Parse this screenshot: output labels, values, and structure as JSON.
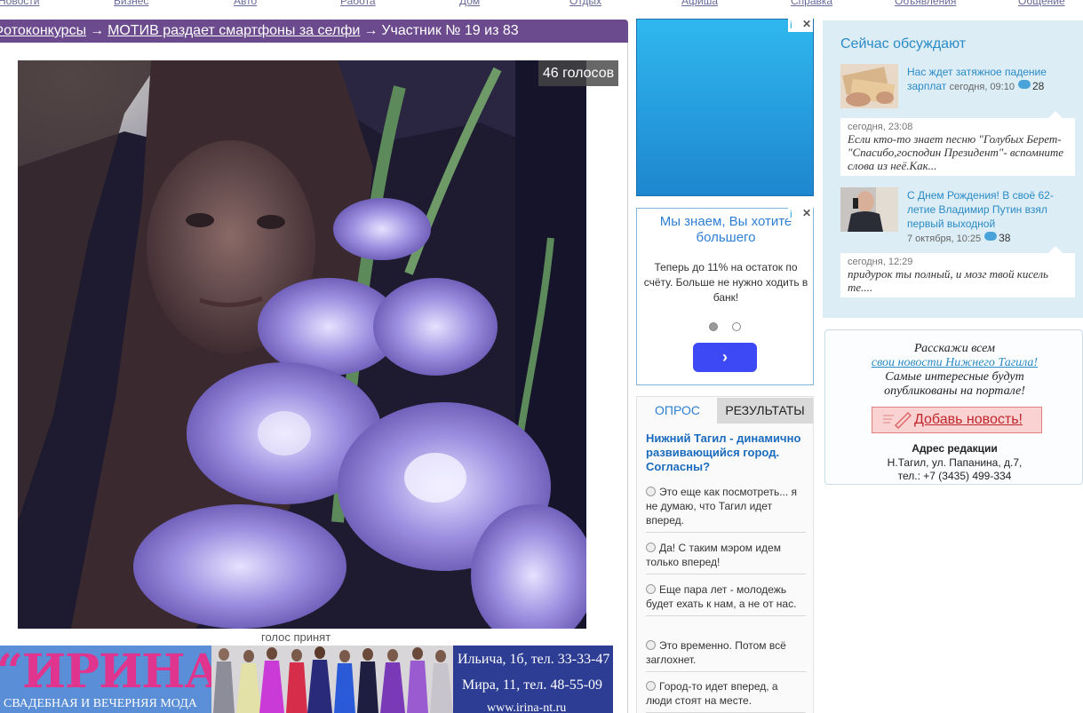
{
  "topnav": [
    {
      "label": "Новости"
    },
    {
      "label": "Бизнес"
    },
    {
      "label": "Авто"
    },
    {
      "label": "Работа"
    },
    {
      "label": "Дом"
    },
    {
      "label": "Отдых"
    },
    {
      "label": "Афиша"
    },
    {
      "label": "Справка"
    },
    {
      "label": "Объявления"
    },
    {
      "label": "Общение"
    }
  ],
  "breadcrumb": {
    "section": "Фотоконкурсы",
    "contest": "МОТИВ раздает смартфоны за селфи",
    "current": "Участник № 19 из 83",
    "separator": "→"
  },
  "photo": {
    "votes": "46 голосов",
    "status": "голос принят"
  },
  "banner": {
    "brand": "“ИРИНА”",
    "subtitle": "СВАДЕБНАЯ И ВЕЧЕРНЯЯ МОДА",
    "address1": "Ильича, 1б, тел. 33-33-47",
    "address2": "Мира, 11, тел. 48-55-09",
    "website": "www.irina-nt.ru"
  },
  "ads": {
    "close_info": "i",
    "close_x": "✕",
    "text_ad": {
      "headline": "Мы знаем, Вы хотите большего",
      "body": "Теперь до 11% на остаток по счёту. Больше не нужно ходить в банк!",
      "button": "›"
    }
  },
  "poll": {
    "tab_vote": "ОПРОС",
    "tab_results": "РЕЗУЛЬТАТЫ",
    "question": "Нижний Тагил - динамично развивающийся город. Согласны?",
    "options": [
      "Это еще как посмотреть... я не думаю, что Тагил идет вперед.",
      "Да! С таким мэром идем только вперед!",
      "Еще пара лет - молодежь будет ехать к нам, а не от нас.",
      "Это временно. Потом всё заглохнет.",
      "Город-то идет вперед, а люди стоят на месте."
    ]
  },
  "discuss": {
    "title": "Сейчас обсуждают",
    "items": [
      {
        "headline": "Нас ждет затяжное падение зарплат",
        "time": "сегодня, 09:10",
        "count": "28",
        "comment_time": "сегодня, 23:08",
        "comment": "Если кто-то знает песню \"Голубых Берет- \"Спасибо,господин Президент\"- вспомните слова из неё.Как..."
      },
      {
        "headline": "С Днем Рождения! В своё 62-летие Владимир Путин взял первый выходной",
        "time": "7 октября, 10:25",
        "count": "38",
        "comment_time": "сегодня, 12:29",
        "comment": "придурок ты полный, и мозг твой кисель те...."
      }
    ]
  },
  "tell": {
    "line1": "Расскажи всем",
    "link": "свои новости Нижнего Тагила!",
    "line3": "Самые интересные будут",
    "line4": "опубликованы на портале!",
    "button": "Добавь новость!",
    "addr_title": "Адрес редакции",
    "addr_line1": "Н.Тагил, ул. Папанина, д.7,",
    "addr_line2": "тел.: +7 (3435) 499-334"
  },
  "colors": {
    "crumb_bg": "#6b4a8e",
    "link_blue": "#2a8bc6",
    "poll_question": "#1a6bbd",
    "ad_button": "#3d49f5",
    "brand_pink": "#e0358e"
  }
}
